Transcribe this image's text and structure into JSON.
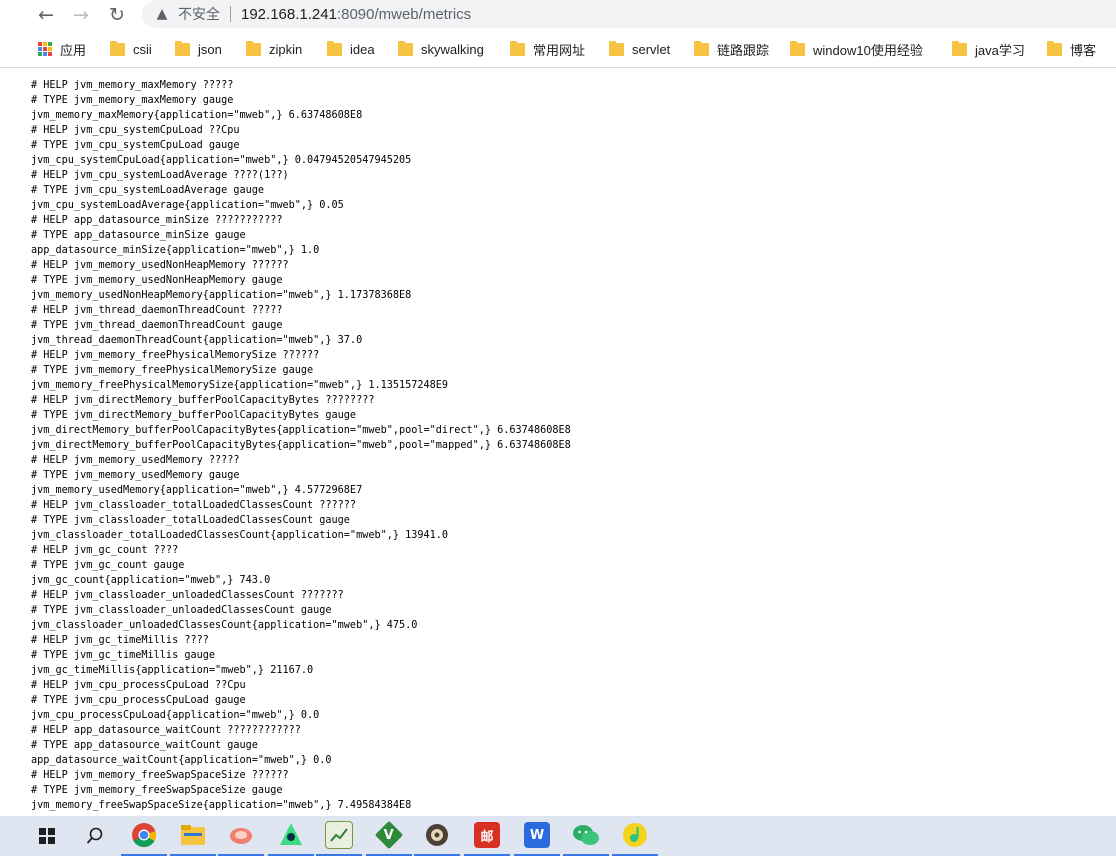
{
  "browser": {
    "back_label": "←",
    "forward_label": "→",
    "reload_label": "↻",
    "security_label": "不安全",
    "url_host": "192.168.1.241",
    "url_rest": ":8090/mweb/metrics"
  },
  "bookmarks": {
    "apps_label": "应用",
    "items": [
      "csii",
      "json",
      "zipkin",
      "idea",
      "skywalking",
      "常用网址",
      "servlet",
      "链路跟踪",
      "window10使用经验",
      "java学习",
      "博客"
    ]
  },
  "metrics_lines": [
    "# HELP jvm_memory_maxMemory ?????",
    "# TYPE jvm_memory_maxMemory gauge",
    "jvm_memory_maxMemory{application=\"mweb\",} 6.63748608E8",
    "# HELP jvm_cpu_systemCpuLoad ??Cpu",
    "# TYPE jvm_cpu_systemCpuLoad gauge",
    "jvm_cpu_systemCpuLoad{application=\"mweb\",} 0.04794520547945205",
    "# HELP jvm_cpu_systemLoadAverage ????(1??)",
    "# TYPE jvm_cpu_systemLoadAverage gauge",
    "jvm_cpu_systemLoadAverage{application=\"mweb\",} 0.05",
    "# HELP app_datasource_minSize ???????????",
    "# TYPE app_datasource_minSize gauge",
    "app_datasource_minSize{application=\"mweb\",} 1.0",
    "# HELP jvm_memory_usedNonHeapMemory ??????",
    "# TYPE jvm_memory_usedNonHeapMemory gauge",
    "jvm_memory_usedNonHeapMemory{application=\"mweb\",} 1.17378368E8",
    "# HELP jvm_thread_daemonThreadCount ?????",
    "# TYPE jvm_thread_daemonThreadCount gauge",
    "jvm_thread_daemonThreadCount{application=\"mweb\",} 37.0",
    "# HELP jvm_memory_freePhysicalMemorySize ??????",
    "# TYPE jvm_memory_freePhysicalMemorySize gauge",
    "jvm_memory_freePhysicalMemorySize{application=\"mweb\",} 1.135157248E9",
    "# HELP jvm_directMemory_bufferPoolCapacityBytes ????????",
    "# TYPE jvm_directMemory_bufferPoolCapacityBytes gauge",
    "jvm_directMemory_bufferPoolCapacityBytes{application=\"mweb\",pool=\"direct\",} 6.63748608E8",
    "jvm_directMemory_bufferPoolCapacityBytes{application=\"mweb\",pool=\"mapped\",} 6.63748608E8",
    "# HELP jvm_memory_usedMemory ?????",
    "# TYPE jvm_memory_usedMemory gauge",
    "jvm_memory_usedMemory{application=\"mweb\",} 4.5772968E7",
    "# HELP jvm_classloader_totalLoadedClassesCount ??????",
    "# TYPE jvm_classloader_totalLoadedClassesCount gauge",
    "jvm_classloader_totalLoadedClassesCount{application=\"mweb\",} 13941.0",
    "# HELP jvm_gc_count ????",
    "# TYPE jvm_gc_count gauge",
    "jvm_gc_count{application=\"mweb\",} 743.0",
    "# HELP jvm_classloader_unloadedClassesCount ???????",
    "# TYPE jvm_classloader_unloadedClassesCount gauge",
    "jvm_classloader_unloadedClassesCount{application=\"mweb\",} 475.0",
    "# HELP jvm_gc_timeMillis ????",
    "# TYPE jvm_gc_timeMillis gauge",
    "jvm_gc_timeMillis{application=\"mweb\",} 21167.0",
    "# HELP jvm_cpu_processCpuLoad ??Cpu",
    "# TYPE jvm_cpu_processCpuLoad gauge",
    "jvm_cpu_processCpuLoad{application=\"mweb\",} 0.0",
    "# HELP app_datasource_waitCount ????????????",
    "# TYPE app_datasource_waitCount gauge",
    "app_datasource_waitCount{application=\"mweb\",} 0.0",
    "# HELP jvm_memory_freeSwapSpaceSize ??????",
    "# TYPE jvm_memory_freeSwapSpaceSize gauge",
    "jvm_memory_freeSwapSpaceSize{application=\"mweb\",} 7.49584384E8"
  ],
  "taskbar": {
    "start_icon": "windows-start-icon",
    "search_icon": "search-icon",
    "mail_label": "邮",
    "colors": {
      "taskbar_bg": "#dfe6f1",
      "accent": "#3b78e7"
    }
  }
}
